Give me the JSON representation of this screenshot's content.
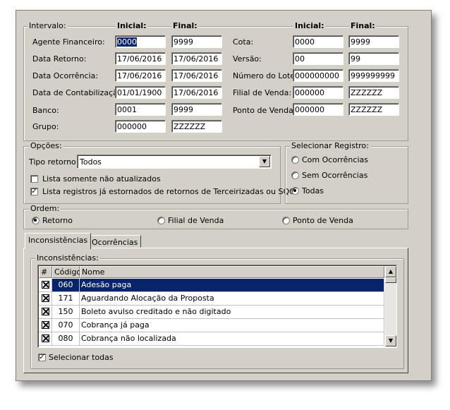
{
  "intervalo": {
    "legend": "Intervalo:",
    "col_inicial": "Inicial:",
    "col_final": "Final:",
    "left_rows": [
      {
        "label": "Agente Financeiro:",
        "inicial": "0000",
        "final": "9999"
      },
      {
        "label": "Data Retorno:",
        "inicial": "17/06/2016",
        "final": "17/06/2016"
      },
      {
        "label": "Data Ocorrência:",
        "inicial": "17/06/2016",
        "final": "17/06/2016"
      },
      {
        "label": "Data de Contabilização:",
        "inicial": "01/01/1900",
        "final": "17/06/2016"
      },
      {
        "label": "Banco:",
        "inicial": "0001",
        "final": "9999"
      },
      {
        "label": "Grupo:",
        "inicial": "000000",
        "final": "ZZZZZZ"
      }
    ],
    "right_rows": [
      {
        "label": "Cota:",
        "inicial": "0000",
        "final": "9999"
      },
      {
        "label": "Versão:",
        "inicial": "00",
        "final": "99"
      },
      {
        "label": "Número do Lote:",
        "inicial": "000000000",
        "final": "999999999"
      },
      {
        "label": "Filial de Venda:",
        "inicial": "000000",
        "final": "ZZZZZZ"
      },
      {
        "label": "Ponto de Venda:",
        "inicial": "000000",
        "final": "ZZZZZZ"
      }
    ]
  },
  "opcoes": {
    "legend": "Opções:",
    "tipo_label": "Tipo retorno:",
    "tipo_value": "Todos",
    "check1": {
      "label": "Lista somente não atualizados",
      "checked": false
    },
    "check2": {
      "label": "Lista registros já estornados de retornos de Terceirizadas ou SQG",
      "checked": true
    }
  },
  "selecionar": {
    "legend": "Selecionar Registro:",
    "options": [
      "Com Ocorrências",
      "Sem Ocorrências",
      "Todas"
    ],
    "selected": "Todas"
  },
  "ordem": {
    "legend": "Ordem:",
    "options": [
      "Retorno",
      "Filial de Venda",
      "Ponto de Venda"
    ],
    "selected": "Retorno"
  },
  "tabs": [
    "Inconsistências",
    "Ocorrências"
  ],
  "active_tab": "Inconsistências",
  "inconsistencias": {
    "legend": "Inconsistências:",
    "columns": [
      "#",
      "Código",
      "Nome"
    ],
    "rows": [
      {
        "checked": true,
        "codigo": "060",
        "nome": "Adesão paga"
      },
      {
        "checked": true,
        "codigo": "171",
        "nome": "Aguardando Alocação da Proposta"
      },
      {
        "checked": true,
        "codigo": "150",
        "nome": "Boleto avulso creditado e não digitado"
      },
      {
        "checked": true,
        "codigo": "070",
        "nome": "Cobrança já paga"
      },
      {
        "checked": true,
        "codigo": "080",
        "nome": "Cobrança não localizada"
      }
    ],
    "select_all_label": "Selecionar todas",
    "select_all_checked": true
  },
  "colors": {
    "selection": "#0a246a",
    "window_bg": "#d4d0c8"
  }
}
